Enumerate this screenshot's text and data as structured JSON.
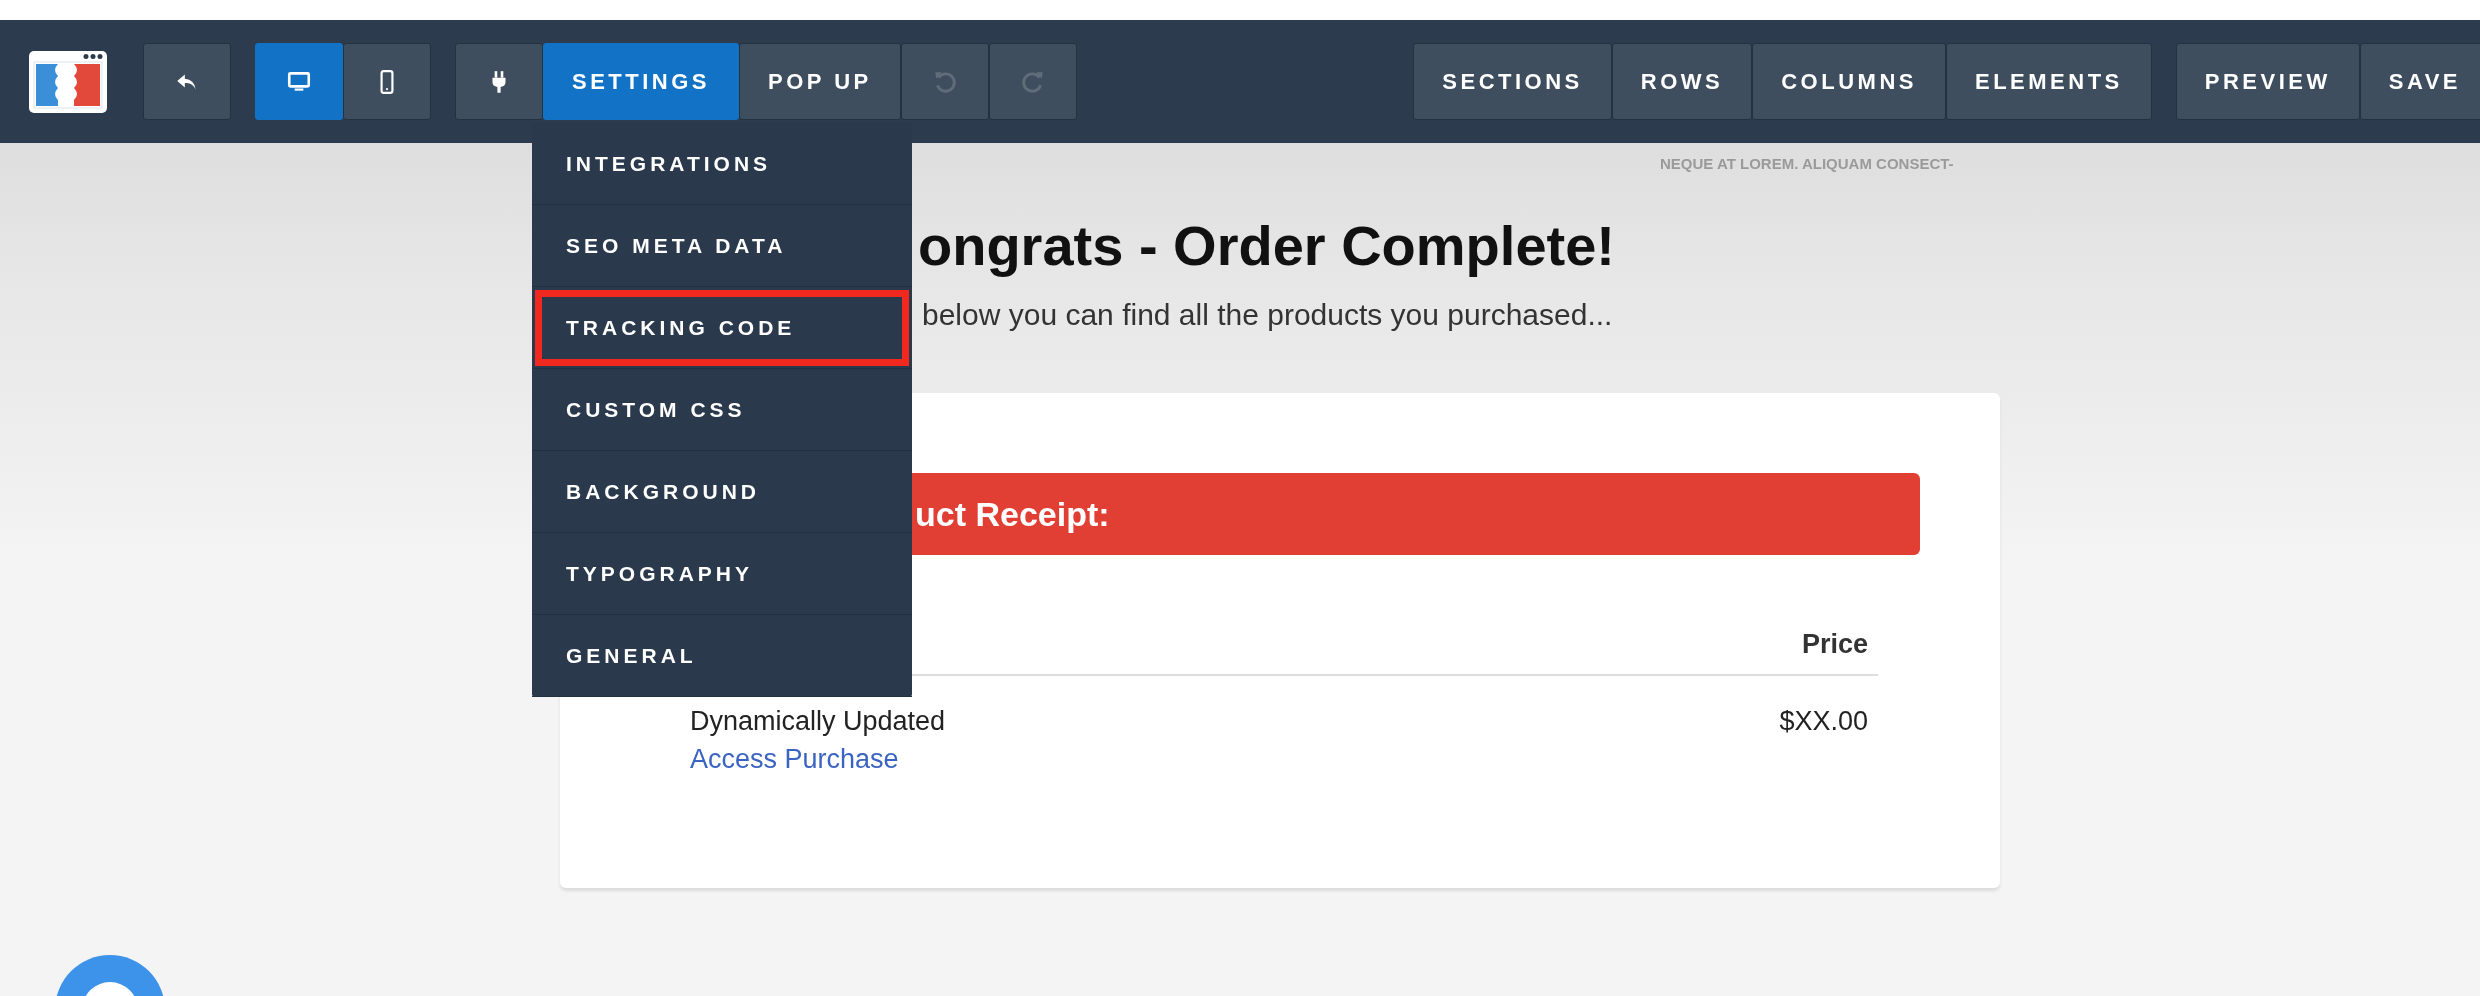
{
  "toolbar": {
    "left_groups": [
      {
        "buttons": [
          {
            "kind": "back",
            "selected": false,
            "disabled": false
          }
        ]
      },
      {
        "buttons": [
          {
            "kind": "desktop",
            "selected": true,
            "disabled": false
          },
          {
            "kind": "mobile",
            "selected": false,
            "disabled": false
          }
        ]
      },
      {
        "buttons": [
          {
            "kind": "plug",
            "selected": false,
            "disabled": false
          },
          {
            "kind": "text",
            "label": "SETTINGS",
            "selected": true,
            "disabled": false
          },
          {
            "kind": "text",
            "label": "POP UP",
            "selected": false,
            "disabled": false
          },
          {
            "kind": "undo",
            "selected": false,
            "disabled": true
          },
          {
            "kind": "redo",
            "selected": false,
            "disabled": true
          }
        ]
      }
    ],
    "right_groups": [
      {
        "buttons": [
          {
            "kind": "text",
            "label": "SECTIONS",
            "selected": false,
            "disabled": false
          },
          {
            "kind": "text",
            "label": "ROWS",
            "selected": false,
            "disabled": false
          },
          {
            "kind": "text",
            "label": "COLUMNS",
            "selected": false,
            "disabled": false
          },
          {
            "kind": "text",
            "label": "ELEMENTS",
            "selected": false,
            "disabled": false
          }
        ]
      },
      {
        "buttons": [
          {
            "kind": "text",
            "label": "PREVIEW",
            "selected": false,
            "disabled": false
          },
          {
            "kind": "text",
            "label": "SAVE",
            "selected": false,
            "disabled": false
          }
        ]
      }
    ]
  },
  "settings_menu": {
    "items": [
      {
        "label": "INTEGRATIONS",
        "highlighted": false
      },
      {
        "label": "SEO META DATA",
        "highlighted": false
      },
      {
        "label": "TRACKING CODE",
        "highlighted": true
      },
      {
        "label": "CUSTOM CSS",
        "highlighted": false
      },
      {
        "label": "BACKGROUND",
        "highlighted": false
      },
      {
        "label": "TYPOGRAPHY",
        "highlighted": false
      },
      {
        "label": "GENERAL",
        "highlighted": false
      }
    ]
  },
  "background_text": "NEQUE AT LOREM. ALIQUAM CONSECT-",
  "page": {
    "heading": "ongrats - Order Complete!",
    "subtitle": "below you can find all the products you purchased...",
    "receipt": {
      "banner": "uct Receipt:",
      "columns": [
        "Price"
      ],
      "rows": [
        {
          "name": "Dynamically Updated",
          "link": "Access Purchase",
          "price": "$XX.00"
        }
      ]
    }
  }
}
